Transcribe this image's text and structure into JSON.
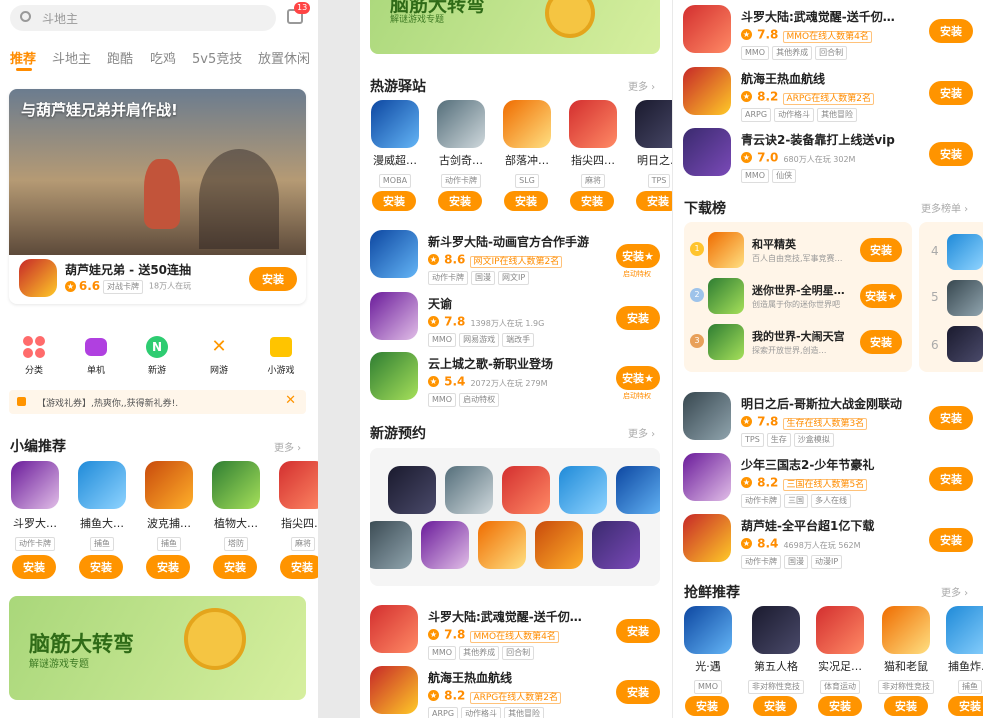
{
  "search": {
    "placeholder": "斗地主",
    "badge": "13"
  },
  "tabs": [
    "推荐",
    "斗地主",
    "跑酷",
    "吃鸡",
    "5v5竞技",
    "放置休闲"
  ],
  "banner": {
    "headline": "与葫芦娃兄弟并肩作战!",
    "game": "葫芦娃兄弟 - 送50连抽",
    "rating": "6.6",
    "tag": "对战卡牌",
    "players": "18万人在玩",
    "install": "安装"
  },
  "categories": [
    {
      "label": "分类",
      "icon": "category-icon"
    },
    {
      "label": "单机",
      "icon": "gamepad-icon"
    },
    {
      "label": "新游",
      "icon": "new-icon"
    },
    {
      "label": "网游",
      "icon": "swords-icon"
    },
    {
      "label": "小游戏",
      "icon": "mini-game-icon"
    }
  ],
  "notice": "【游戏礼券】,热爽你,,获得新礼券!.",
  "editor_picks": {
    "title": "小编推荐",
    "more": "更多",
    "items": [
      {
        "name": "斗罗大…",
        "tag": "动作卡牌",
        "install": "安装"
      },
      {
        "name": "捕鱼大…",
        "tag": "捕鱼",
        "install": "安装"
      },
      {
        "name": "波克捕…",
        "tag": "捕鱼",
        "install": "安装"
      },
      {
        "name": "植物大…",
        "tag": "塔防",
        "install": "安装"
      },
      {
        "name": "指尖四…",
        "tag": "麻将",
        "install": "安装"
      }
    ]
  },
  "promo": {
    "title": "脑筋大转弯",
    "subtitle": "解谜游戏专题"
  },
  "hot": {
    "title": "热游驿站",
    "more": "更多",
    "items": [
      {
        "name": "漫威超…",
        "tag": "MOBA",
        "install": "安装"
      },
      {
        "name": "古剑奇…",
        "tag": "动作卡牌",
        "install": "安装"
      },
      {
        "name": "部落冲…",
        "tag": "SLG",
        "install": "安装"
      },
      {
        "name": "指尖四…",
        "tag": "麻将",
        "install": "安装"
      },
      {
        "name": "明日之…",
        "tag": "TPS",
        "install": "安装"
      }
    ]
  },
  "list_a": [
    {
      "name": "新斗罗大陆-动画官方合作手游",
      "rating": "8.6",
      "rank": "网文IP在线人数第2名",
      "tags": [
        "动作卡牌",
        "国漫",
        "网文IP"
      ],
      "install": "安装",
      "privilege": "启动特权"
    },
    {
      "name": "天谕",
      "rating": "7.8",
      "stats": "1398万人在玩  1.9G",
      "tags": [
        "MMO",
        "网易游戏",
        "端改手"
      ],
      "install": "安装"
    },
    {
      "name": "云上城之歌-新职业登场",
      "rating": "5.4",
      "stats": "2072万人在玩  279M",
      "tags": [
        "MMO",
        "启动特权"
      ],
      "install": "安装",
      "privilege": "启动特权"
    }
  ],
  "preorder": {
    "title": "新游预约",
    "more": "更多"
  },
  "list_b": [
    {
      "name": "斗罗大陆:武魂觉醒-送千仞…",
      "rating": "7.8",
      "rank": "MMO在线人数第4名",
      "tags": [
        "MMO",
        "其他养成",
        "回合制"
      ],
      "install": "安装"
    },
    {
      "name": "航海王热血航线",
      "rating": "8.2",
      "rank": "ARPG在线人数第2名",
      "tags": [
        "ARPG",
        "动作格斗",
        "其他冒险"
      ],
      "install": "安装"
    }
  ],
  "list_c": [
    {
      "name": "斗罗大陆:武魂觉醒-送千仞…",
      "rating": "7.8",
      "rank": "MMO在线人数第4名",
      "tags": [
        "MMO",
        "其他养成",
        "回合制"
      ],
      "install": "安装"
    },
    {
      "name": "航海王热血航线",
      "rating": "8.2",
      "rank": "ARPG在线人数第2名",
      "tags": [
        "ARPG",
        "动作格斗",
        "其他冒险"
      ],
      "install": "安装"
    },
    {
      "name": "青云诀2-装备靠打上线送vip",
      "rating": "7.0",
      "stats": "680万人在玩  302M",
      "tags": [
        "MMO",
        "仙侠"
      ],
      "install": "安装"
    }
  ],
  "downloads": {
    "title": "下载榜",
    "more": "更多榜单",
    "items": [
      {
        "rank": "1",
        "name": "和平精英",
        "desc": "百人自由竞技,军事竞赛…",
        "install": "安装"
      },
      {
        "rank": "2",
        "name": "迷你世界-全明星…",
        "desc": "创造属于你的迷你世界吧",
        "install": "安装"
      },
      {
        "rank": "3",
        "name": "我的世界-大闹天宫",
        "desc": "探索开放世界,创造…",
        "install": "安装"
      }
    ],
    "side_ranks": [
      "4",
      "5",
      "6"
    ]
  },
  "list_d": [
    {
      "name": "明日之后-哥斯拉大战金刚联动",
      "rating": "7.8",
      "rank": "生存在线人数第3名",
      "tags": [
        "TPS",
        "生存",
        "沙盒模拟"
      ],
      "install": "安装"
    },
    {
      "name": "少年三国志2-少年节豪礼",
      "rating": "8.2",
      "rank": "三国在线人数第5名",
      "tags": [
        "动作卡牌",
        "三国",
        "多人在线"
      ],
      "install": "安装"
    },
    {
      "name": "葫芦娃-全平台超1亿下载",
      "rating": "8.4",
      "stats": "4698万人在玩  562M",
      "tags": [
        "动作卡牌",
        "国漫",
        "动漫IP"
      ],
      "install": "安装"
    }
  ],
  "fresh": {
    "title": "抢鲜推荐",
    "more": "更多",
    "items": [
      {
        "name": "光·遇",
        "tag": "MMO",
        "install": "安装"
      },
      {
        "name": "第五人格",
        "tag": "非对称性竞技",
        "install": "安装"
      },
      {
        "name": "实况足…",
        "tag": "体育运动",
        "install": "安装"
      },
      {
        "name": "猫和老鼠",
        "tag": "非对称性竞技",
        "install": "安装"
      },
      {
        "name": "捕鱼炸…",
        "tag": "捕鱼",
        "install": "安装"
      }
    ]
  }
}
